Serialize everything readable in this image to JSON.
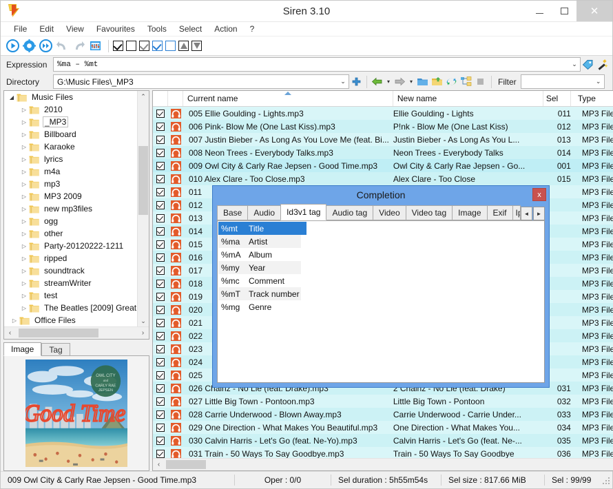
{
  "window": {
    "title": "Siren 3.10",
    "app_icon": "siren-app-icon",
    "minimize": "–",
    "maximize": "▢",
    "close": "✕"
  },
  "menubar": {
    "items": [
      {
        "label": "File",
        "name": "menu-file"
      },
      {
        "label": "Edit",
        "name": "menu-edit"
      },
      {
        "label": "View",
        "name": "menu-view"
      },
      {
        "label": "Favourites",
        "name": "menu-favourites"
      },
      {
        "label": "Tools",
        "name": "menu-tools"
      },
      {
        "label": "Select",
        "name": "menu-select"
      },
      {
        "label": "Action",
        "name": "menu-action"
      },
      {
        "label": "?",
        "name": "menu-help"
      }
    ]
  },
  "toolbar": {
    "icons": [
      {
        "name": "run-icon",
        "glyph": "▶"
      },
      {
        "name": "settings-icon",
        "glyph": "⚙"
      },
      {
        "name": "fast-forward-icon",
        "glyph": "⏩"
      },
      {
        "name": "undo-icon",
        "glyph": "↶"
      },
      {
        "name": "redo-icon",
        "glyph": "↷"
      },
      {
        "name": "tag-editor-icon",
        "glyph": "▤"
      }
    ],
    "checkboxes": [
      {
        "name": "select-all-icon",
        "state": "checked"
      },
      {
        "name": "select-none-icon",
        "state": "unchecked"
      },
      {
        "name": "invert-selection-icon",
        "state": "checked-gray"
      },
      {
        "name": "check-selected-icon",
        "state": "checked-blue"
      },
      {
        "name": "uncheck-selected-icon",
        "state": "unchecked-blue"
      },
      {
        "name": "move-up-icon",
        "state": "triangle-up"
      },
      {
        "name": "move-down-icon",
        "state": "triangle-down"
      }
    ]
  },
  "expression_bar": {
    "label": "Expression",
    "value": "%ma  –  %mt",
    "dropdown_arrow": "⌄",
    "tag_button": "tag-icon",
    "wand_button": "magic-wand-icon"
  },
  "directory_bar": {
    "label": "Directory",
    "value": "G:\\Music Files\\_MP3",
    "dropdown_arrow": "⌄",
    "buttons": [
      {
        "name": "add-directory-icon",
        "glyph": "+"
      },
      {
        "name": "back-icon",
        "glyph": "◀"
      },
      {
        "name": "back-dropdown-icon",
        "glyph": "▾"
      },
      {
        "name": "forward-icon",
        "glyph": "▶"
      },
      {
        "name": "forward-dropdown-icon",
        "glyph": "▾"
      },
      {
        "name": "open-folder-icon",
        "glyph": "📁"
      },
      {
        "name": "parent-folder-icon",
        "glyph": "📂"
      },
      {
        "name": "refresh-icon",
        "glyph": "⟳"
      },
      {
        "name": "tree-view-icon",
        "glyph": "⊞"
      },
      {
        "name": "stop-icon",
        "glyph": "■"
      }
    ],
    "filter_label": "Filter",
    "filter_value": "",
    "filter_arrow": "⌄"
  },
  "tree": {
    "root": {
      "label": "Music Files",
      "expanded": true
    },
    "items": [
      {
        "label": "2010",
        "selected": false
      },
      {
        "label": "_MP3",
        "selected": true
      },
      {
        "label": "Billboard",
        "selected": false
      },
      {
        "label": "Karaoke",
        "selected": false
      },
      {
        "label": "lyrics",
        "selected": false
      },
      {
        "label": "m4a",
        "selected": false
      },
      {
        "label": "mp3",
        "selected": false
      },
      {
        "label": "MP3 2009",
        "selected": false
      },
      {
        "label": "new mp3files",
        "selected": false
      },
      {
        "label": "ogg",
        "selected": false
      },
      {
        "label": "other",
        "selected": false
      },
      {
        "label": "Party-20120222-1211",
        "selected": false
      },
      {
        "label": "ripped",
        "selected": false
      },
      {
        "label": "soundtrack",
        "selected": false
      },
      {
        "label": "streamWriter",
        "selected": false
      },
      {
        "label": "test",
        "selected": false
      },
      {
        "label": "The Beatles [2009] Great",
        "selected": false
      }
    ],
    "footer": {
      "label": "Office Files",
      "expanded": false
    },
    "scroll_up": "⌃",
    "scroll_down": "⌄",
    "hscroll_left": "‹",
    "hscroll_right": "›"
  },
  "preview_panel": {
    "tabs": [
      {
        "label": "Image",
        "active": true
      },
      {
        "label": "Tag",
        "active": false
      }
    ],
    "album_art_alt": "Owl City & Carly Rae Jepsen - Good Time cover art",
    "album_art_text": "Good Time",
    "album_art_badge": "OWL CITY and CARLY RAE JEPSEN"
  },
  "file_list": {
    "columns": [
      {
        "label": "",
        "name": "checkbox-column"
      },
      {
        "label": "",
        "name": "icon-column"
      },
      {
        "label": "Current name",
        "name": "column-current-name",
        "sorted": true
      },
      {
        "label": "New name",
        "name": "column-new-name"
      },
      {
        "label": "Sel",
        "name": "column-sel"
      },
      {
        "label": "Type",
        "name": "column-type"
      }
    ],
    "rows": [
      {
        "checked": true,
        "current": "005 Ellie Goulding - Lights.mp3",
        "new": "Ellie Goulding - Lights",
        "sel": "011",
        "type": "MP3 File",
        "selected": false
      },
      {
        "checked": true,
        "current": "006 Pink- Blow Me (One Last Kiss).mp3",
        "new": "P!nk - Blow Me (One Last Kiss)",
        "sel": "012",
        "type": "MP3 File",
        "selected": false
      },
      {
        "checked": true,
        "current": "007 Justin Bieber - As Long As You Love Me (feat. Bi...",
        "new": "Justin Bieber - As Long As You L...",
        "sel": "013",
        "type": "MP3 File",
        "selected": false
      },
      {
        "checked": true,
        "current": "008 Neon Trees - Everybody Talks.mp3",
        "new": "Neon Trees - Everybody Talks",
        "sel": "014",
        "type": "MP3 File",
        "selected": false
      },
      {
        "checked": true,
        "current": "009 Owl City & Carly Rae Jepsen - Good Time.mp3",
        "new": "Owl City & Carly Rae Jepsen - Go...",
        "sel": "001",
        "type": "MP3 File",
        "selected": true
      },
      {
        "checked": true,
        "current": "010 Alex Clare - Too Close.mp3",
        "new": "Alex Clare - Too Close",
        "sel": "015",
        "type": "MP3 File",
        "selected": false
      },
      {
        "checked": true,
        "current": "011",
        "new": "",
        "sel": "",
        "type": "MP3 File",
        "selected": false
      },
      {
        "checked": true,
        "current": "012",
        "new": "",
        "sel": "",
        "type": "MP3 File",
        "selected": false
      },
      {
        "checked": true,
        "current": "013",
        "new": "",
        "sel": "",
        "type": "MP3 File",
        "selected": false
      },
      {
        "checked": true,
        "current": "014",
        "new": "",
        "sel": "",
        "type": "MP3 File",
        "selected": false
      },
      {
        "checked": true,
        "current": "015",
        "new": "",
        "sel": "",
        "type": "MP3 File",
        "selected": false
      },
      {
        "checked": true,
        "current": "016",
        "new": "",
        "sel": "",
        "type": "MP3 File",
        "selected": false
      },
      {
        "checked": true,
        "current": "017",
        "new": "",
        "sel": "",
        "type": "MP3 File",
        "selected": false
      },
      {
        "checked": true,
        "current": "018",
        "new": "",
        "sel": "",
        "type": "MP3 File",
        "selected": false
      },
      {
        "checked": true,
        "current": "019",
        "new": "",
        "sel": "",
        "type": "MP3 File",
        "selected": false
      },
      {
        "checked": true,
        "current": "020",
        "new": "",
        "sel": "",
        "type": "MP3 File",
        "selected": false
      },
      {
        "checked": true,
        "current": "021",
        "new": "",
        "sel": "",
        "type": "MP3 File",
        "selected": false
      },
      {
        "checked": true,
        "current": "022",
        "new": "",
        "sel": "",
        "type": "MP3 File",
        "selected": false
      },
      {
        "checked": true,
        "current": "023",
        "new": "",
        "sel": "",
        "type": "MP3 File",
        "selected": false
      },
      {
        "checked": true,
        "current": "024",
        "new": "",
        "sel": "",
        "type": "MP3 File",
        "selected": false
      },
      {
        "checked": true,
        "current": "025",
        "new": "",
        "sel": "",
        "type": "MP3 File",
        "selected": false
      },
      {
        "checked": true,
        "current": "026 Chainz - No Lie (feat. Drake).mp3",
        "new": "2 Chainz - No Lie (feat. Drake)",
        "sel": "031",
        "type": "MP3 File",
        "selected": false
      },
      {
        "checked": true,
        "current": "027 Little Big Town - Pontoon.mp3",
        "new": "Little Big Town - Pontoon",
        "sel": "032",
        "type": "MP3 File",
        "selected": false
      },
      {
        "checked": true,
        "current": "028 Carrie Underwood - Blown Away.mp3",
        "new": "Carrie Underwood - Carrie Under...",
        "sel": "033",
        "type": "MP3 File",
        "selected": false
      },
      {
        "checked": true,
        "current": "029 One Direction - What Makes You Beautiful.mp3",
        "new": "One Direction - What Makes You...",
        "sel": "034",
        "type": "MP3 File",
        "selected": false
      },
      {
        "checked": true,
        "current": "030 Calvin Harris - Let's Go (feat. Ne-Yo).mp3",
        "new": "Calvin Harris - Let's Go (feat. Ne-...",
        "sel": "035",
        "type": "MP3 File",
        "selected": false
      },
      {
        "checked": true,
        "current": "031 Train - 50 Ways To Say Goodbye.mp3",
        "new": "Train - 50 Ways To Say Goodbye",
        "sel": "036",
        "type": "MP3 File",
        "selected": false
      }
    ],
    "scroll_up": "⌃",
    "scroll_down": "⌄",
    "hscroll_left": "‹",
    "hscroll_right": "›"
  },
  "dialog": {
    "title": "Completion",
    "close_label": "x",
    "tabs": [
      {
        "label": "Base",
        "active": false
      },
      {
        "label": "Audio",
        "active": false
      },
      {
        "label": "Id3v1 tag",
        "active": true
      },
      {
        "label": "Audio tag",
        "active": false
      },
      {
        "label": "Video",
        "active": false
      },
      {
        "label": "Video tag",
        "active": false
      },
      {
        "label": "Image",
        "active": false
      },
      {
        "label": "Exif",
        "active": false
      },
      {
        "label": "Ipt",
        "active": false,
        "clipped": true
      }
    ],
    "tab_nav_prev": "◄",
    "tab_nav_next": "►",
    "entries": [
      {
        "code": "%mt",
        "name": "Title",
        "selected": true
      },
      {
        "code": "%ma",
        "name": "Artist",
        "selected": false
      },
      {
        "code": "%mA",
        "name": "Album",
        "selected": false
      },
      {
        "code": "%my",
        "name": "Year",
        "selected": false
      },
      {
        "code": "%mc",
        "name": "Comment",
        "selected": false
      },
      {
        "code": "%mT",
        "name": "Track number",
        "selected": false
      },
      {
        "code": "%mg",
        "name": "Genre",
        "selected": false
      }
    ]
  },
  "statusbar": {
    "current_file": "009 Owl City & Carly Rae Jepsen - Good Time.mp3",
    "oper": "Oper : 0/0",
    "sel_duration": "Sel duration : 5h55m54s",
    "sel_size": "Sel size : 817.66 MiB",
    "sel_count": "Sel : 99/99"
  },
  "colors": {
    "list_row_a": "#d9f6f8",
    "list_row_b": "#ccf2f5",
    "dialog_chrome": "#6ea5e8",
    "selection_blue": "#2a7fd4",
    "close_red": "#c9524f",
    "audio_icon": "#e35b2a"
  }
}
